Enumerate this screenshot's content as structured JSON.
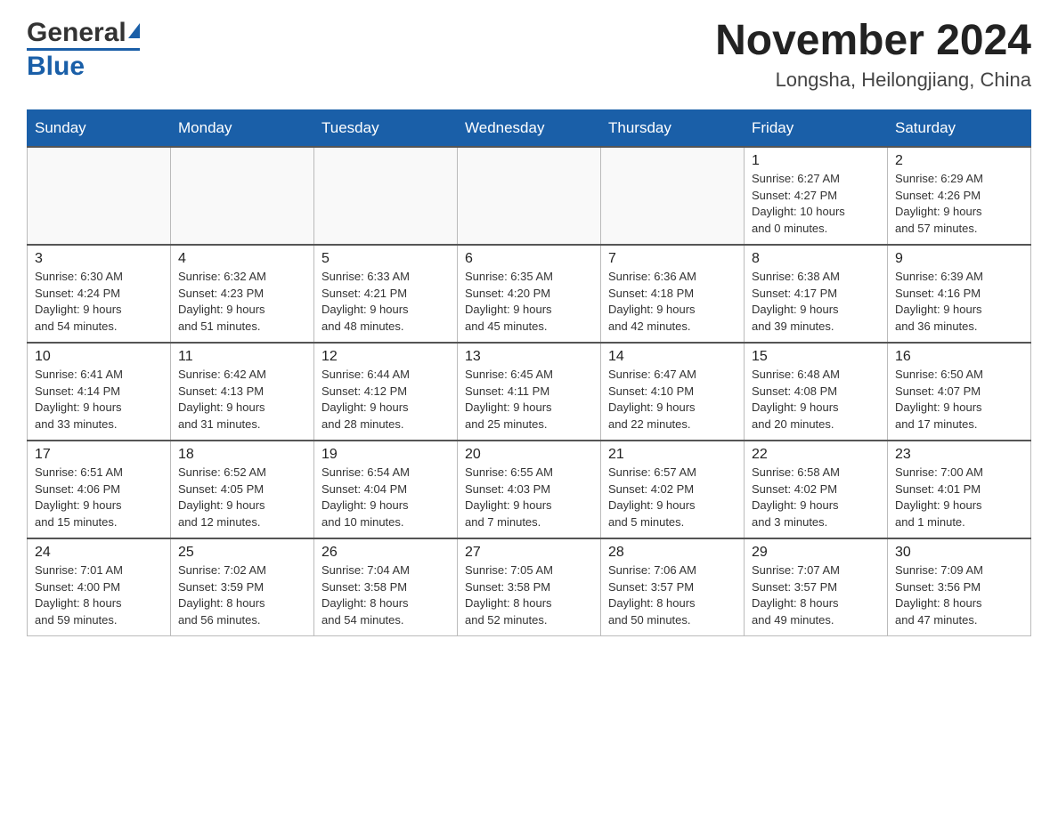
{
  "header": {
    "title": "November 2024",
    "subtitle": "Longsha, Heilongjiang, China",
    "logo_general": "General",
    "logo_blue": "Blue"
  },
  "days_of_week": [
    "Sunday",
    "Monday",
    "Tuesday",
    "Wednesday",
    "Thursday",
    "Friday",
    "Saturday"
  ],
  "weeks": [
    {
      "days": [
        {
          "number": "",
          "info": ""
        },
        {
          "number": "",
          "info": ""
        },
        {
          "number": "",
          "info": ""
        },
        {
          "number": "",
          "info": ""
        },
        {
          "number": "",
          "info": ""
        },
        {
          "number": "1",
          "info": "Sunrise: 6:27 AM\nSunset: 4:27 PM\nDaylight: 10 hours\nand 0 minutes."
        },
        {
          "number": "2",
          "info": "Sunrise: 6:29 AM\nSunset: 4:26 PM\nDaylight: 9 hours\nand 57 minutes."
        }
      ]
    },
    {
      "days": [
        {
          "number": "3",
          "info": "Sunrise: 6:30 AM\nSunset: 4:24 PM\nDaylight: 9 hours\nand 54 minutes."
        },
        {
          "number": "4",
          "info": "Sunrise: 6:32 AM\nSunset: 4:23 PM\nDaylight: 9 hours\nand 51 minutes."
        },
        {
          "number": "5",
          "info": "Sunrise: 6:33 AM\nSunset: 4:21 PM\nDaylight: 9 hours\nand 48 minutes."
        },
        {
          "number": "6",
          "info": "Sunrise: 6:35 AM\nSunset: 4:20 PM\nDaylight: 9 hours\nand 45 minutes."
        },
        {
          "number": "7",
          "info": "Sunrise: 6:36 AM\nSunset: 4:18 PM\nDaylight: 9 hours\nand 42 minutes."
        },
        {
          "number": "8",
          "info": "Sunrise: 6:38 AM\nSunset: 4:17 PM\nDaylight: 9 hours\nand 39 minutes."
        },
        {
          "number": "9",
          "info": "Sunrise: 6:39 AM\nSunset: 4:16 PM\nDaylight: 9 hours\nand 36 minutes."
        }
      ]
    },
    {
      "days": [
        {
          "number": "10",
          "info": "Sunrise: 6:41 AM\nSunset: 4:14 PM\nDaylight: 9 hours\nand 33 minutes."
        },
        {
          "number": "11",
          "info": "Sunrise: 6:42 AM\nSunset: 4:13 PM\nDaylight: 9 hours\nand 31 minutes."
        },
        {
          "number": "12",
          "info": "Sunrise: 6:44 AM\nSunset: 4:12 PM\nDaylight: 9 hours\nand 28 minutes."
        },
        {
          "number": "13",
          "info": "Sunrise: 6:45 AM\nSunset: 4:11 PM\nDaylight: 9 hours\nand 25 minutes."
        },
        {
          "number": "14",
          "info": "Sunrise: 6:47 AM\nSunset: 4:10 PM\nDaylight: 9 hours\nand 22 minutes."
        },
        {
          "number": "15",
          "info": "Sunrise: 6:48 AM\nSunset: 4:08 PM\nDaylight: 9 hours\nand 20 minutes."
        },
        {
          "number": "16",
          "info": "Sunrise: 6:50 AM\nSunset: 4:07 PM\nDaylight: 9 hours\nand 17 minutes."
        }
      ]
    },
    {
      "days": [
        {
          "number": "17",
          "info": "Sunrise: 6:51 AM\nSunset: 4:06 PM\nDaylight: 9 hours\nand 15 minutes."
        },
        {
          "number": "18",
          "info": "Sunrise: 6:52 AM\nSunset: 4:05 PM\nDaylight: 9 hours\nand 12 minutes."
        },
        {
          "number": "19",
          "info": "Sunrise: 6:54 AM\nSunset: 4:04 PM\nDaylight: 9 hours\nand 10 minutes."
        },
        {
          "number": "20",
          "info": "Sunrise: 6:55 AM\nSunset: 4:03 PM\nDaylight: 9 hours\nand 7 minutes."
        },
        {
          "number": "21",
          "info": "Sunrise: 6:57 AM\nSunset: 4:02 PM\nDaylight: 9 hours\nand 5 minutes."
        },
        {
          "number": "22",
          "info": "Sunrise: 6:58 AM\nSunset: 4:02 PM\nDaylight: 9 hours\nand 3 minutes."
        },
        {
          "number": "23",
          "info": "Sunrise: 7:00 AM\nSunset: 4:01 PM\nDaylight: 9 hours\nand 1 minute."
        }
      ]
    },
    {
      "days": [
        {
          "number": "24",
          "info": "Sunrise: 7:01 AM\nSunset: 4:00 PM\nDaylight: 8 hours\nand 59 minutes."
        },
        {
          "number": "25",
          "info": "Sunrise: 7:02 AM\nSunset: 3:59 PM\nDaylight: 8 hours\nand 56 minutes."
        },
        {
          "number": "26",
          "info": "Sunrise: 7:04 AM\nSunset: 3:58 PM\nDaylight: 8 hours\nand 54 minutes."
        },
        {
          "number": "27",
          "info": "Sunrise: 7:05 AM\nSunset: 3:58 PM\nDaylight: 8 hours\nand 52 minutes."
        },
        {
          "number": "28",
          "info": "Sunrise: 7:06 AM\nSunset: 3:57 PM\nDaylight: 8 hours\nand 50 minutes."
        },
        {
          "number": "29",
          "info": "Sunrise: 7:07 AM\nSunset: 3:57 PM\nDaylight: 8 hours\nand 49 minutes."
        },
        {
          "number": "30",
          "info": "Sunrise: 7:09 AM\nSunset: 3:56 PM\nDaylight: 8 hours\nand 47 minutes."
        }
      ]
    }
  ]
}
